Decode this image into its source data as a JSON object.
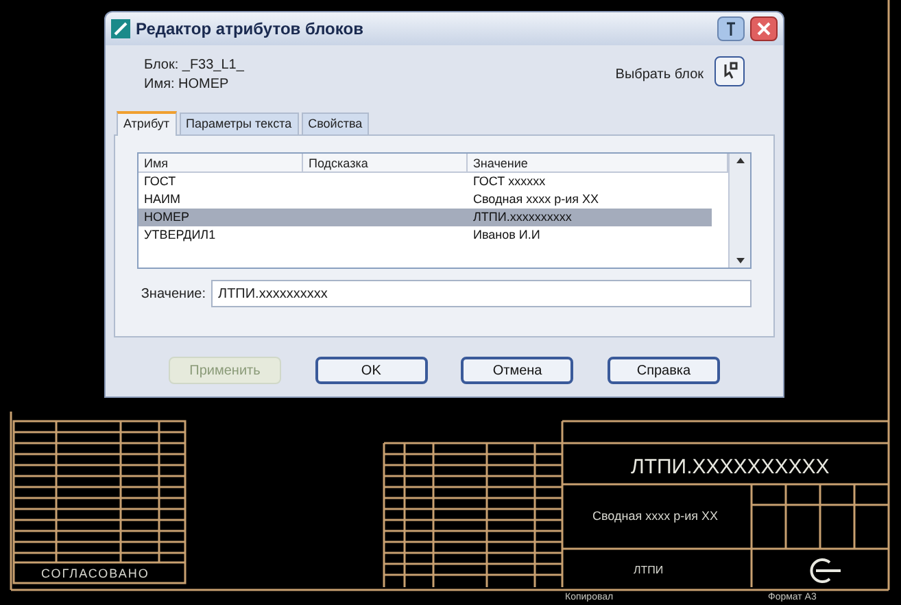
{
  "window": {
    "title": "Редактор атрибутов блоков"
  },
  "block_label": "Блок: _F33_L1_",
  "tag_label": "Имя: НОМЕР",
  "select_block": "Выбрать блок",
  "tabs": [
    {
      "label": "Атрибут",
      "selected": true
    },
    {
      "label": "Параметры текста",
      "selected": false
    },
    {
      "label": "Свойства",
      "selected": false
    }
  ],
  "table": {
    "columns": [
      "Имя",
      "Подсказка",
      "Значение"
    ],
    "rows": [
      {
        "name": "ГОСТ",
        "value": "ГОСТ xxxxxx",
        "selected": false
      },
      {
        "name": "НАИМ",
        "value": "Сводная xxxx p-ия XX",
        "selected": false
      },
      {
        "name": "НОМЕР",
        "value": "ЛТПИ.xxxxxxxxxx",
        "selected": true
      },
      {
        "name": "УТВЕРДИЛ1",
        "value": "Иванов И.И",
        "selected": false
      }
    ]
  },
  "value_field": {
    "label": "Значение:",
    "value": "ЛТПИ.xxxxxxxxxx"
  },
  "buttons": [
    {
      "label": "Применить",
      "disabled": true
    },
    {
      "label": "OK",
      "disabled": false
    },
    {
      "label": "Отмена",
      "disabled": false
    },
    {
      "label": "Справка",
      "disabled": false
    }
  ],
  "drawing": {
    "left_stamp": "СОГЛАСОВАНО",
    "designation": "ЛТПИ.XXXXXXXXXX",
    "name": "Сводная xxxx p-ия XX",
    "org": "ЛТПИ",
    "footer": [
      "Копировал",
      "Формат А3"
    ]
  }
}
